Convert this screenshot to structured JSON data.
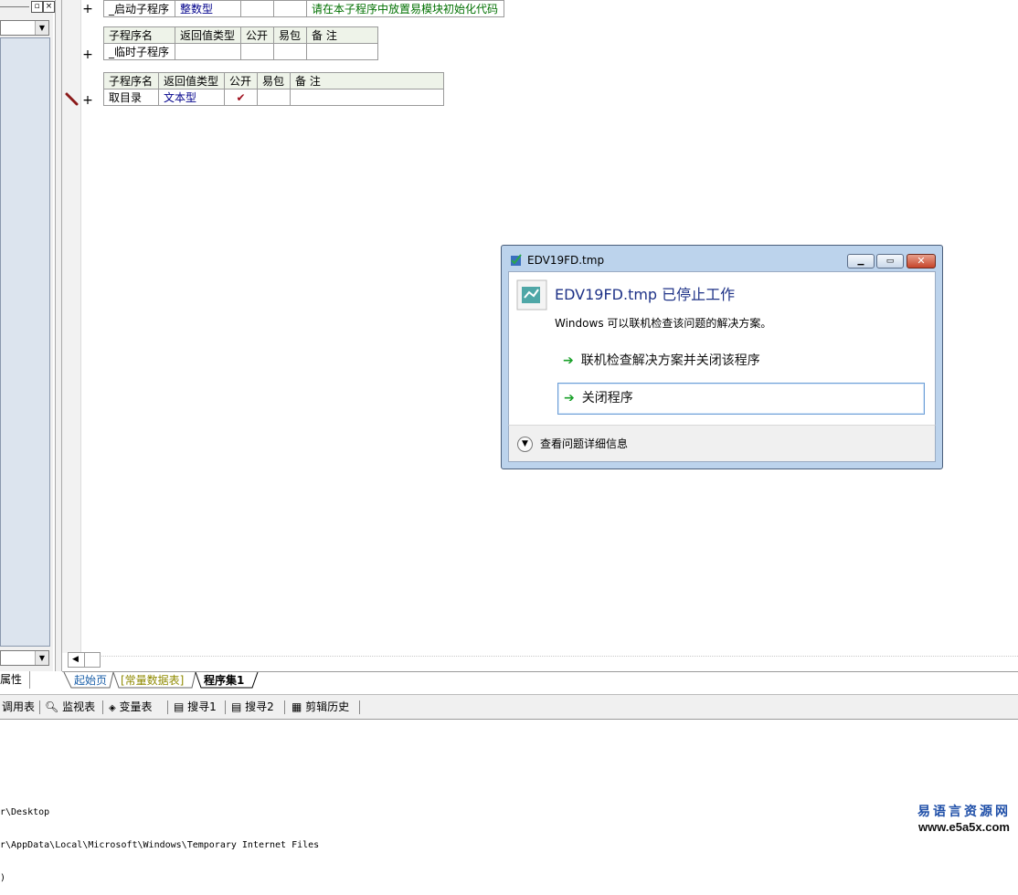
{
  "left_panel": {
    "properties_tab": "属性"
  },
  "tables": [
    {
      "rows": [
        [
          "_启动子程序",
          "整数型",
          "",
          "",
          "请在本子程序中放置易模块初始化代码"
        ]
      ]
    },
    {
      "header": [
        "子程序名",
        "返回值类型",
        "公开",
        "易包",
        "备 注"
      ],
      "rows": [
        [
          "_临时子程序",
          "",
          "",
          "",
          ""
        ]
      ]
    },
    {
      "header": [
        "子程序名",
        "返回值类型",
        "公开",
        "易包",
        "备 注"
      ],
      "rows": [
        [
          "取目录",
          "文本型",
          "✔",
          "",
          ""
        ]
      ]
    }
  ],
  "gutter": {
    "plus": "+"
  },
  "tabs": [
    "起始页",
    "[常量数据表]",
    "程序集1"
  ],
  "toolbar": [
    "调用表",
    "监视表",
    "变量表",
    "搜寻1",
    "搜寻2",
    "剪辑历史"
  ],
  "output_lines": [
    "r\\Desktop",
    "r\\AppData\\Local\\Microsoft\\Windows\\Temporary Internet Files",
    ")"
  ],
  "watermark": {
    "title": "易语言资源网",
    "url": "www.e5a5x.com"
  },
  "dialog": {
    "title": "EDV19FD.tmp",
    "heading": "EDV19FD.tmp 已停止工作",
    "message": "Windows 可以联机检查该问题的解决方案。",
    "option1": "联机检查解决方案并关闭该程序",
    "option2": "关闭程序",
    "details": "查看问题详细信息"
  }
}
